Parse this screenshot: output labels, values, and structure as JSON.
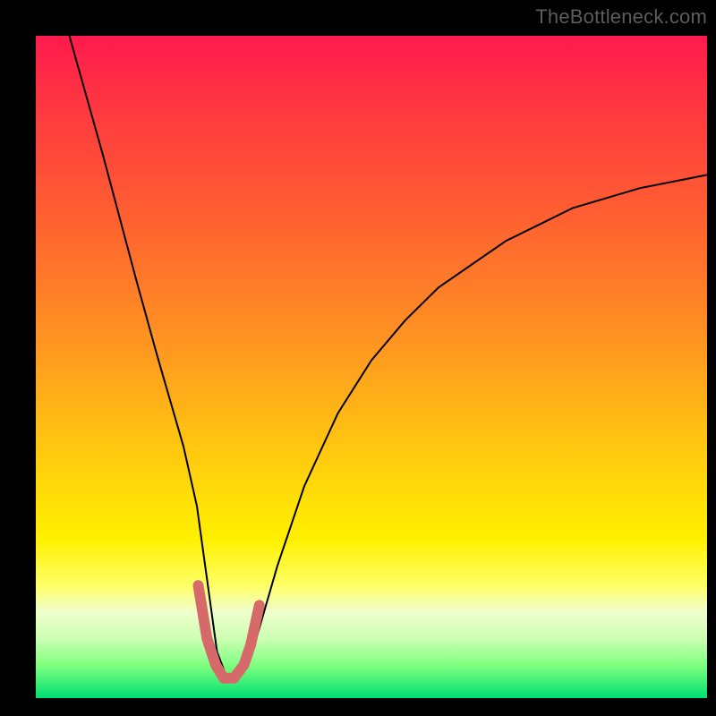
{
  "watermark": {
    "text": "TheBottleneck.com"
  },
  "chart_data": {
    "type": "line",
    "title": "",
    "xlabel": "",
    "ylabel": "",
    "xlim": [
      0,
      100
    ],
    "ylim": [
      0,
      100
    ],
    "grid": false,
    "legend": false,
    "background_gradient": {
      "top": "#ff1a4d",
      "middle": "#ffd90a",
      "bottom": "#00e070"
    },
    "series": [
      {
        "name": "bottleneck-curve",
        "color": "#000000",
        "stroke_width": 2,
        "x": [
          5,
          10,
          15,
          18,
          20,
          22,
          24,
          25.5,
          27,
          28.5,
          30,
          32,
          34,
          36,
          40,
          45,
          50,
          55,
          60,
          70,
          80,
          90,
          100
        ],
        "y": [
          100,
          82,
          63,
          52,
          45,
          38,
          29,
          18,
          7,
          3,
          3,
          6,
          13,
          20,
          32,
          43,
          51,
          57,
          62,
          69,
          74,
          77,
          79
        ]
      },
      {
        "name": "u-highlight",
        "color": "#d66a6a",
        "stroke_width": 12,
        "linecap": "round",
        "x": [
          24.2,
          25.5,
          26.8,
          28.0,
          29.5,
          31.0,
          32.0,
          33.3
        ],
        "y": [
          17,
          9,
          5,
          3,
          3,
          5,
          8,
          14
        ]
      }
    ]
  }
}
